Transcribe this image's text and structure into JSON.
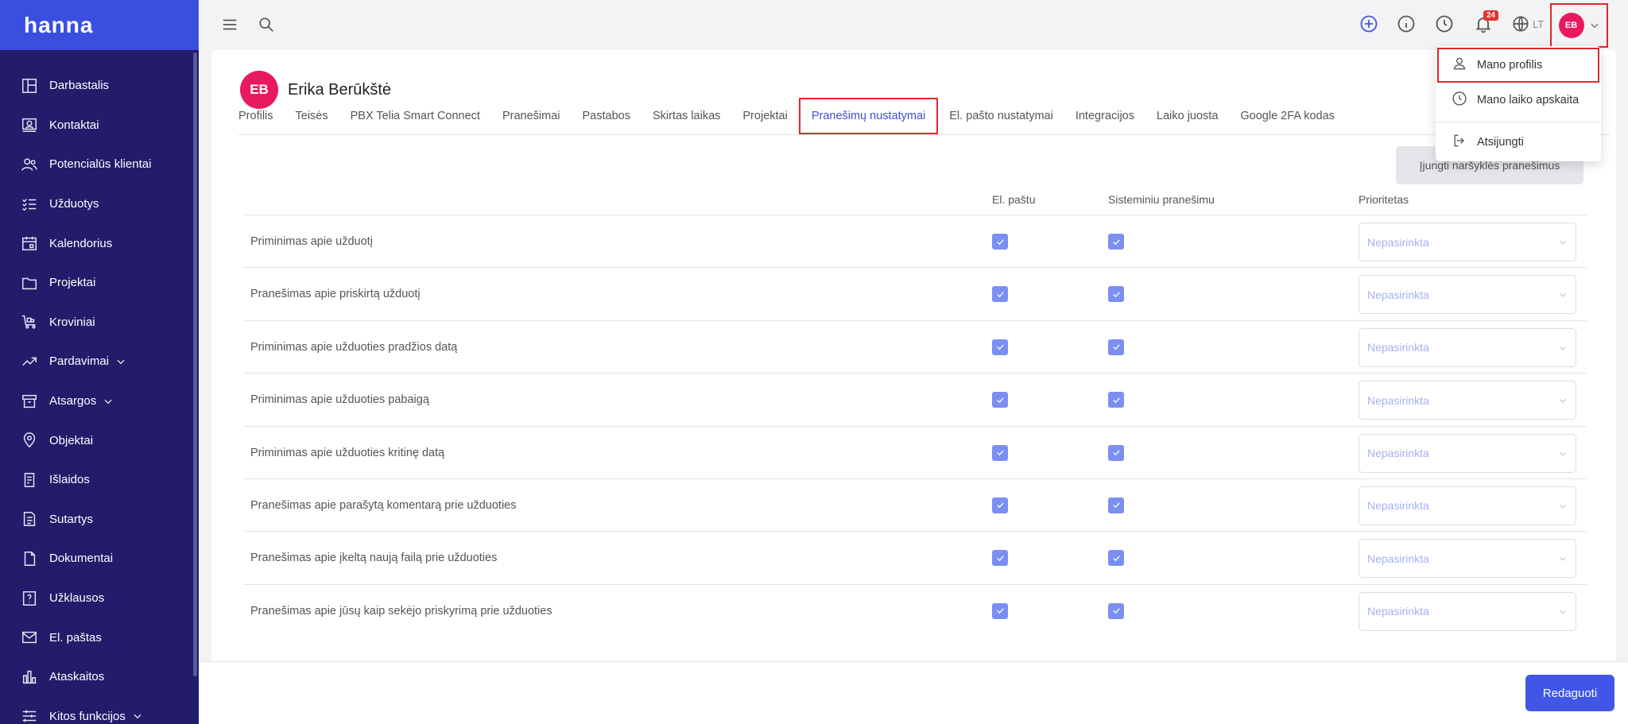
{
  "app": {
    "logo": "hanna"
  },
  "sidebar": {
    "items": [
      {
        "label": "Darbastalis",
        "icon": "dashboard-icon"
      },
      {
        "label": "Kontaktai",
        "icon": "contacts-icon"
      },
      {
        "label": "Potencialūs klientai",
        "icon": "leads-icon"
      },
      {
        "label": "Užduotys",
        "icon": "tasks-icon"
      },
      {
        "label": "Kalendorius",
        "icon": "calendar-icon"
      },
      {
        "label": "Projektai",
        "icon": "folder-icon"
      },
      {
        "label": "Kroviniai",
        "icon": "cargo-icon"
      },
      {
        "label": "Pardavimai",
        "icon": "sales-icon",
        "expandable": true
      },
      {
        "label": "Atsargos",
        "icon": "stock-icon",
        "expandable": true
      },
      {
        "label": "Objektai",
        "icon": "location-icon"
      },
      {
        "label": "Išlaidos",
        "icon": "expenses-icon"
      },
      {
        "label": "Sutartys",
        "icon": "contracts-icon"
      },
      {
        "label": "Dokumentai",
        "icon": "documents-icon"
      },
      {
        "label": "Užklausos",
        "icon": "inquiries-icon"
      },
      {
        "label": "El. paštas",
        "icon": "mail-icon"
      },
      {
        "label": "Ataskaitos",
        "icon": "reports-icon"
      },
      {
        "label": "Kitos funkcijos",
        "icon": "settings-sliders-icon",
        "expandable": true
      }
    ]
  },
  "topbar": {
    "notifications_count": "24",
    "language": "LT",
    "avatar_initials": "EB"
  },
  "profile": {
    "initials": "EB",
    "name": "Erika Berūkštė"
  },
  "tabs": [
    {
      "label": "Profilis",
      "active": false
    },
    {
      "label": "Teisės",
      "active": false
    },
    {
      "label": "PBX Telia Smart Connect",
      "active": false
    },
    {
      "label": "Pranešimai",
      "active": false
    },
    {
      "label": "Pastabos",
      "active": false
    },
    {
      "label": "Skirtas laikas",
      "active": false
    },
    {
      "label": "Projektai",
      "active": false
    },
    {
      "label": "Pranešimų nustatymai",
      "active": true
    },
    {
      "label": "El. pašto nustatymai",
      "active": false
    },
    {
      "label": "Integracijos",
      "active": false
    },
    {
      "label": "Laiko juosta",
      "active": false
    },
    {
      "label": "Google 2FA kodas",
      "active": false
    }
  ],
  "settings": {
    "browser_button": "Įjungti naršyklės pranešimus",
    "columns": {
      "email": "El. paštu",
      "system": "Sisteminiu pranešimu",
      "priority": "Prioritetas"
    },
    "select_placeholder": "Nepasirinkta",
    "rows": [
      {
        "label": "Priminimas apie užduotį",
        "email": true,
        "system": true
      },
      {
        "label": "Pranešimas apie priskirtą užduotį",
        "email": true,
        "system": true
      },
      {
        "label": "Priminimas apie užduoties pradžios datą",
        "email": true,
        "system": true
      },
      {
        "label": "Priminimas apie užduoties pabaigą",
        "email": true,
        "system": true
      },
      {
        "label": "Priminimas apie užduoties kritinę datą",
        "email": true,
        "system": true
      },
      {
        "label": "Pranešimas apie parašytą komentarą prie užduoties",
        "email": true,
        "system": true
      },
      {
        "label": "Pranešimas apie įkeltą naują failą prie užduoties",
        "email": true,
        "system": true
      },
      {
        "label": "Pranešimas apie jūsų kaip sekėjo priskyrimą prie užduoties",
        "email": true,
        "system": true
      }
    ]
  },
  "footer": {
    "edit_button": "Redaguoti"
  },
  "user_menu": {
    "items": [
      {
        "label": "Mano profilis",
        "icon": "user-icon"
      },
      {
        "label": "Mano laiko apskaita",
        "icon": "clock-icon"
      },
      {
        "label": "Atsijungti",
        "icon": "logout-icon"
      }
    ]
  },
  "colors": {
    "sidebar": "#221c6b",
    "logo_bg": "#3a4fe0",
    "accent": "#3f51d6",
    "avatar": "#e8195f",
    "checkbox": "#7b8ff2",
    "highlight": "#e0262b"
  }
}
